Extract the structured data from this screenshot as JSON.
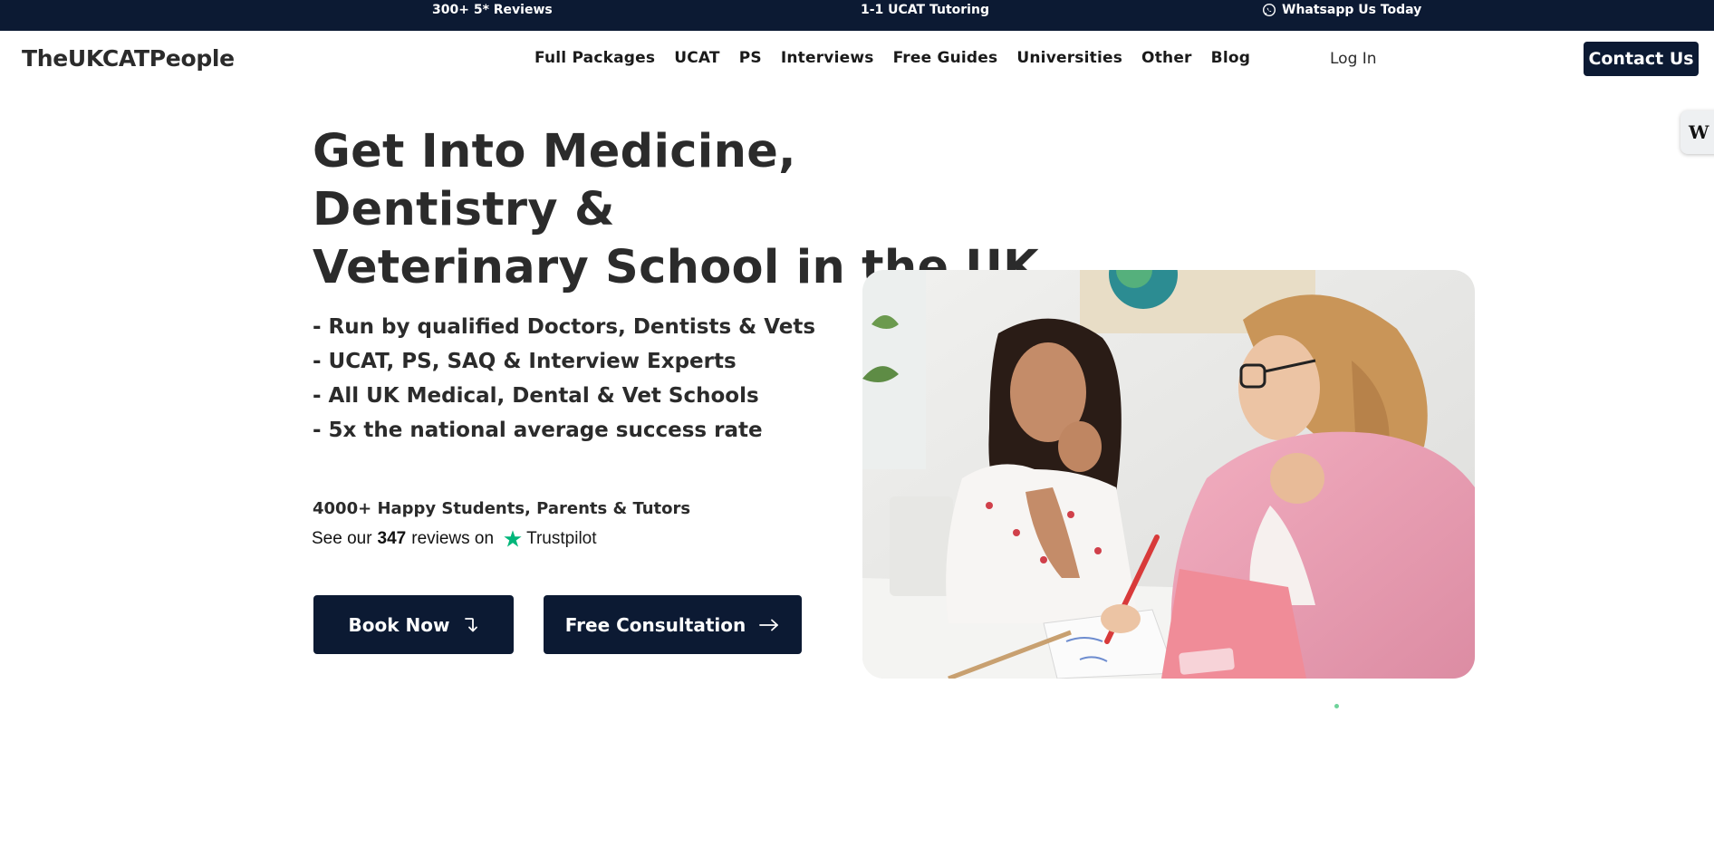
{
  "topbar": {
    "reviews": "300+ 5* Reviews",
    "tutoring": "1-1 UCAT Tutoring",
    "whatsapp": "Whatsapp Us Today",
    "whatsapp_icon": "whatsapp-icon"
  },
  "header": {
    "logo": "TheUKCATPeople",
    "nav": [
      "Full Packages",
      "UCAT",
      "PS",
      "Interviews",
      "Free Guides",
      "Universities",
      "Other",
      "Blog"
    ],
    "login": "Log In",
    "contact": "Contact Us"
  },
  "side_widget": {
    "label": "W"
  },
  "hero": {
    "title_line1": "Get Into Medicine, Dentistry &",
    "title_line2": "Veterinary School in the UK",
    "bullets": [
      "- Run by qualified Doctors, Dentists & Vets",
      "- UCAT, PS, SAQ & Interview Experts",
      "- All UK Medical, Dental & Vet Schools",
      "- 5x the national average success rate"
    ],
    "happy": "4000+ Happy Students, Parents & Tutors",
    "trustpilot": {
      "prefix": "See our",
      "count": "347",
      "suffix": "reviews on",
      "brand": "Trustpilot"
    },
    "book_now": "Book Now",
    "free_consultation": "Free Consultation"
  },
  "colors": {
    "navy": "#0c1a33",
    "trustpilot_green": "#00b67a",
    "photo_jacket_pink": "#e99ab0"
  }
}
